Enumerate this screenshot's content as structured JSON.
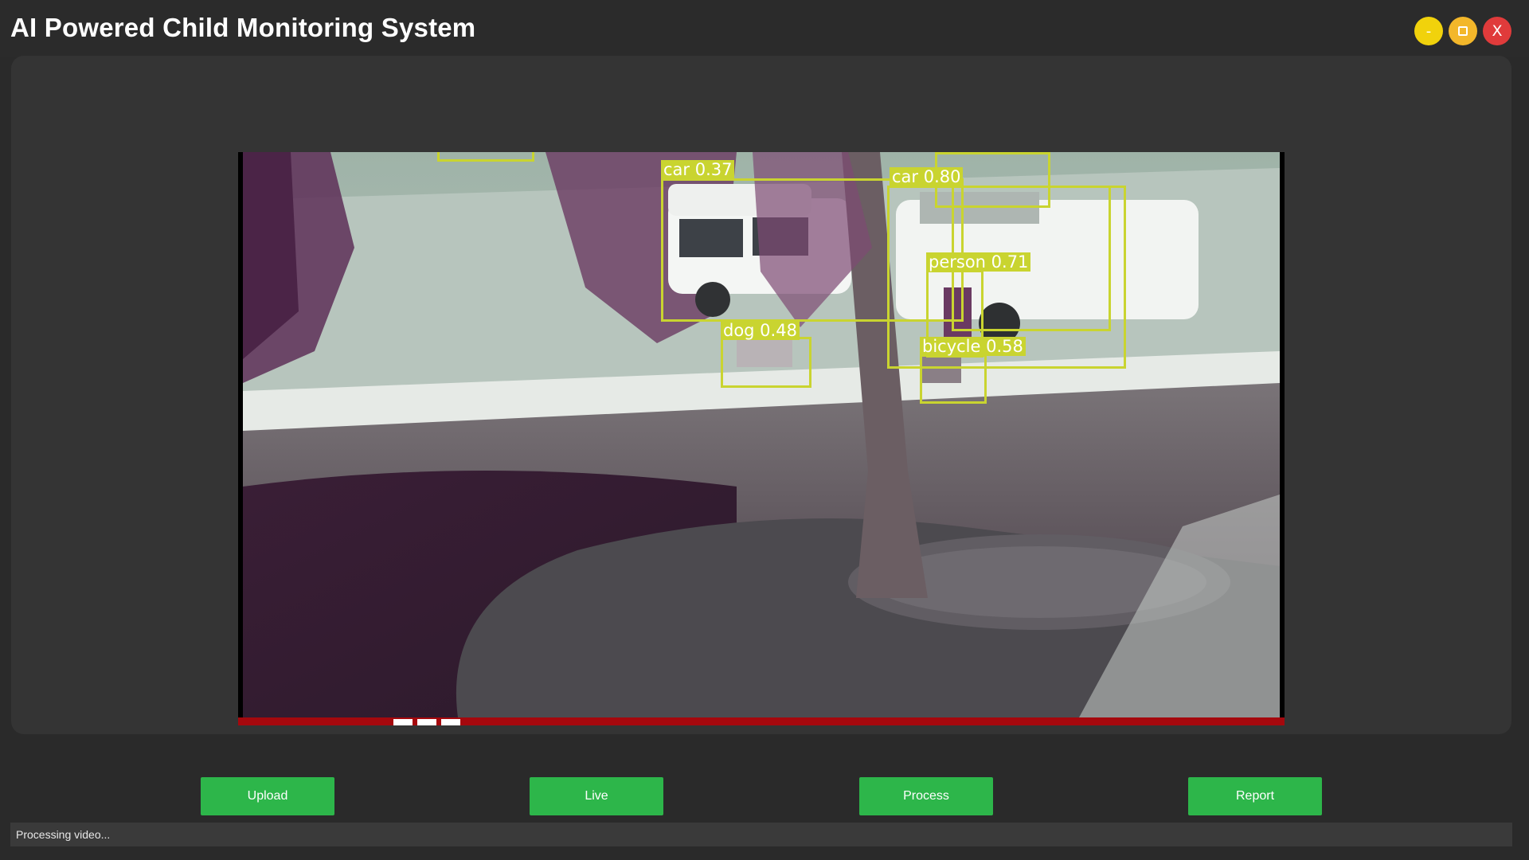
{
  "window": {
    "title": "AI Powered Child Monitoring System",
    "controls": {
      "minimize_label": "-",
      "close_label": "X"
    }
  },
  "video": {
    "detections": [
      {
        "label": "car 0.37"
      },
      {
        "label": "car 0.80"
      },
      {
        "label": "person 0.71"
      },
      {
        "label": "dog 0.48"
      },
      {
        "label": "bicycle 0.58"
      }
    ]
  },
  "toolbar": {
    "upload_label": "Upload",
    "live_label": "Live",
    "process_label": "Process",
    "report_label": "Report"
  },
  "status": {
    "text": "Processing video..."
  },
  "colors": {
    "background": "#2a2a2a",
    "panel": "#343434",
    "button_green": "#2db64a",
    "detection_box": "#c9d430",
    "minimize": "#f1d20c",
    "maximize": "#f3b72a",
    "close": "#e03b3b"
  }
}
